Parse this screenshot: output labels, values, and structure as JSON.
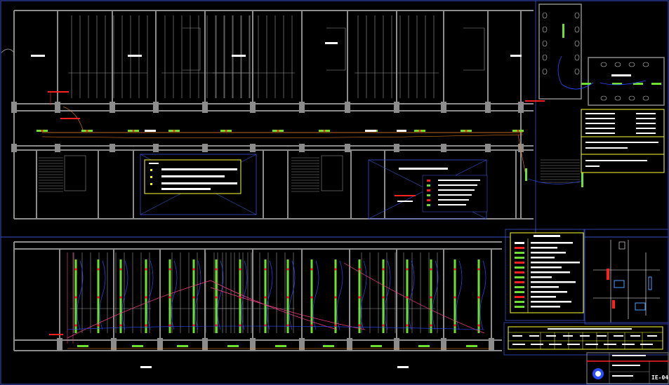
{
  "sheet_number": "IE-04",
  "colors": {
    "background": "#000000",
    "wall": "#8c8c8c",
    "frame": "#3a52c8",
    "circuit_main": "#ff8c1a",
    "circuit_branch": "#2b4bff",
    "circuit_emergency": "#ff3b8a",
    "fixture": "#6fe032",
    "panel_red": "#ff2020",
    "note_box": "#ffff33",
    "label_white": "#ffffff"
  },
  "icons": [
    "lighting-fixture-icon",
    "switch-icon",
    "electric-panel-icon",
    "toilet-icon",
    "north-logo-icon"
  ]
}
